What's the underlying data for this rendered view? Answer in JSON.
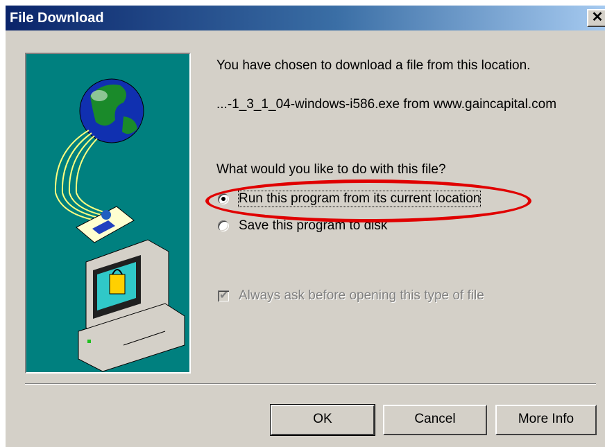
{
  "window": {
    "title": "File Download",
    "close_label": "✕"
  },
  "message": {
    "intro": "You have chosen to download a file from this location.",
    "file_location": "...-1_3_1_04-windows-i586.exe from www.gaincapital.com",
    "question": "What would you like to do with this file?"
  },
  "options": [
    {
      "label": "Run this program from its current location",
      "selected": true
    },
    {
      "label": "Save this program to disk",
      "selected": false
    }
  ],
  "always_ask": {
    "label": "Always ask before opening this type of file",
    "checked": true,
    "enabled": false
  },
  "buttons": {
    "ok": "OK",
    "cancel": "Cancel",
    "more_info": "More Info"
  },
  "colors": {
    "illustration_bg": "#00807f",
    "highlight": "#e00000",
    "title_bar": "#0a246a"
  }
}
